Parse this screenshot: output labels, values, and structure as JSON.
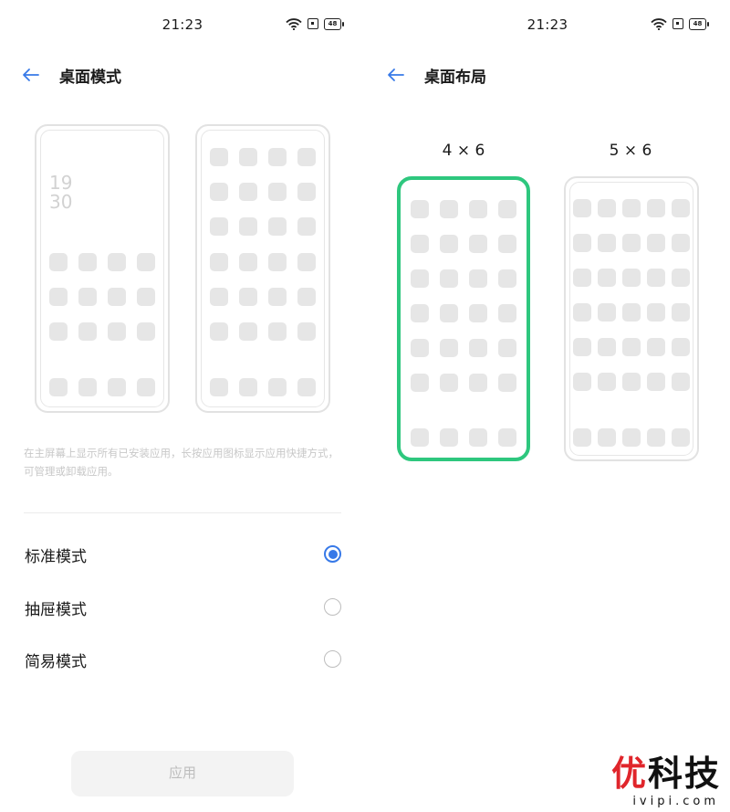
{
  "colors": {
    "accent": "#3779e8",
    "selected_border": "#2ec77e",
    "placeholder": "#e6e6e6"
  },
  "left": {
    "status": {
      "time": "21:23",
      "battery": "48"
    },
    "title": "桌面模式",
    "preview_clock": [
      "19",
      "30"
    ],
    "description": "在主屏幕上显示所有已安装应用，长按应用图标显示应用快捷方式，可管理或卸载应用。",
    "options": [
      {
        "label": "标准模式",
        "selected": true
      },
      {
        "label": "抽屉模式",
        "selected": false
      },
      {
        "label": "简易模式",
        "selected": false
      }
    ],
    "apply_label": "应用"
  },
  "right": {
    "status": {
      "time": "21:23",
      "battery": "48"
    },
    "title": "桌面布局",
    "layouts": [
      {
        "label": "4 × 6",
        "selected": true
      },
      {
        "label": "5 × 6",
        "selected": false
      }
    ]
  },
  "watermark": {
    "main_first": "优",
    "main_rest": "科技",
    "sub": "ivipi.com"
  }
}
